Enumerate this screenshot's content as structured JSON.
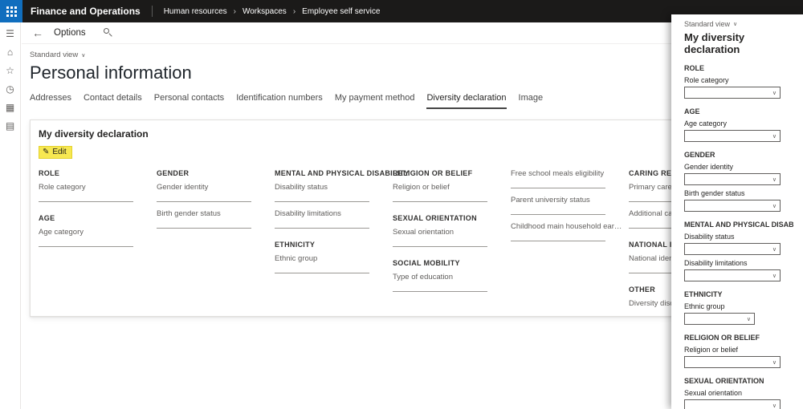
{
  "header": {
    "app_title": "Finance and Operations",
    "breadcrumb": [
      "Human resources",
      "Workspaces",
      "Employee self service"
    ]
  },
  "nav_rail": {
    "icons": [
      {
        "name": "menu-icon",
        "glyph": "☰"
      },
      {
        "name": "home-icon",
        "glyph": "⌂"
      },
      {
        "name": "favorites-star-icon",
        "glyph": "☆"
      },
      {
        "name": "recent-clock-icon",
        "glyph": "◷"
      },
      {
        "name": "workspaces-icon",
        "glyph": "▦"
      },
      {
        "name": "modules-icon",
        "glyph": "▤"
      }
    ]
  },
  "toolbar": {
    "options_label": "Options"
  },
  "page": {
    "view_selector": "Standard view",
    "title": "Personal information",
    "tabs": [
      {
        "label": "Addresses",
        "active": false
      },
      {
        "label": "Contact details",
        "active": false
      },
      {
        "label": "Personal contacts",
        "active": false
      },
      {
        "label": "Identification numbers",
        "active": false
      },
      {
        "label": "My payment method",
        "active": false
      },
      {
        "label": "Diversity declaration",
        "active": true
      },
      {
        "label": "Image",
        "active": false
      }
    ]
  },
  "card": {
    "title": "My diversity declaration",
    "edit_button": "Edit",
    "columns": [
      {
        "groups": [
          {
            "header": "ROLE",
            "fields": [
              "Role category"
            ]
          },
          {
            "header": "AGE",
            "fields": [
              "Age category"
            ]
          }
        ]
      },
      {
        "groups": [
          {
            "header": "GENDER",
            "fields": [
              "Gender identity",
              "Birth gender status"
            ]
          }
        ]
      },
      {
        "groups": [
          {
            "header": "MENTAL AND PHYSICAL DISABILITY",
            "fields": [
              "Disability status",
              "Disability limitations"
            ]
          },
          {
            "header": "ETHNICITY",
            "fields": [
              "Ethnic group"
            ]
          }
        ]
      },
      {
        "groups": [
          {
            "header": "RELIGION OR BELIEF",
            "fields": [
              "Religion or belief"
            ]
          },
          {
            "header": "SEXUAL ORIENTATION",
            "fields": [
              "Sexual orientation"
            ]
          },
          {
            "header": "SOCIAL MOBILITY",
            "fields": [
              "Type of education"
            ]
          }
        ]
      },
      {
        "groups": [
          {
            "header": "",
            "fields": [
              "Free school meals eligibility",
              "Parent university status",
              "Childhood main household earner occupation"
            ]
          }
        ]
      },
      {
        "groups": [
          {
            "header": "CARING RESPONSIBILITIES",
            "fields": [
              "Primary carer",
              "Additional carer responsibilities"
            ]
          },
          {
            "header": "NATIONAL IDENTITY",
            "fields": [
              "National identity"
            ]
          },
          {
            "header": "OTHER",
            "fields": [
              "Diversity disclosure"
            ]
          }
        ]
      }
    ]
  },
  "panel": {
    "view_selector": "Standard view",
    "title": "My diversity declaration",
    "sections": [
      {
        "header": "ROLE",
        "fields": [
          {
            "label": "Role category",
            "value": ""
          }
        ]
      },
      {
        "header": "AGE",
        "fields": [
          {
            "label": "Age category",
            "value": ""
          }
        ]
      },
      {
        "header": "GENDER",
        "fields": [
          {
            "label": "Gender identity",
            "value": ""
          },
          {
            "label": "Birth gender status",
            "value": ""
          }
        ]
      },
      {
        "header": "MENTAL AND PHYSICAL DISABILITY",
        "fields": [
          {
            "label": "Disability status",
            "value": ""
          },
          {
            "label": "Disability limitations",
            "value": ""
          }
        ]
      },
      {
        "header": "ETHNICITY",
        "fields": [
          {
            "label": "Ethnic group",
            "value": "",
            "narrow": true
          }
        ]
      },
      {
        "header": "RELIGION OR BELIEF",
        "fields": [
          {
            "label": "Religion or belief",
            "value": ""
          }
        ]
      },
      {
        "header": "SEXUAL ORIENTATION",
        "fields": [
          {
            "label": "Sexual orientation",
            "value": ""
          }
        ]
      }
    ]
  },
  "colors": {
    "header_bg": "#1b1a19",
    "app_launcher_blue": "#106ebe",
    "edit_highlight": "#f7e851"
  }
}
